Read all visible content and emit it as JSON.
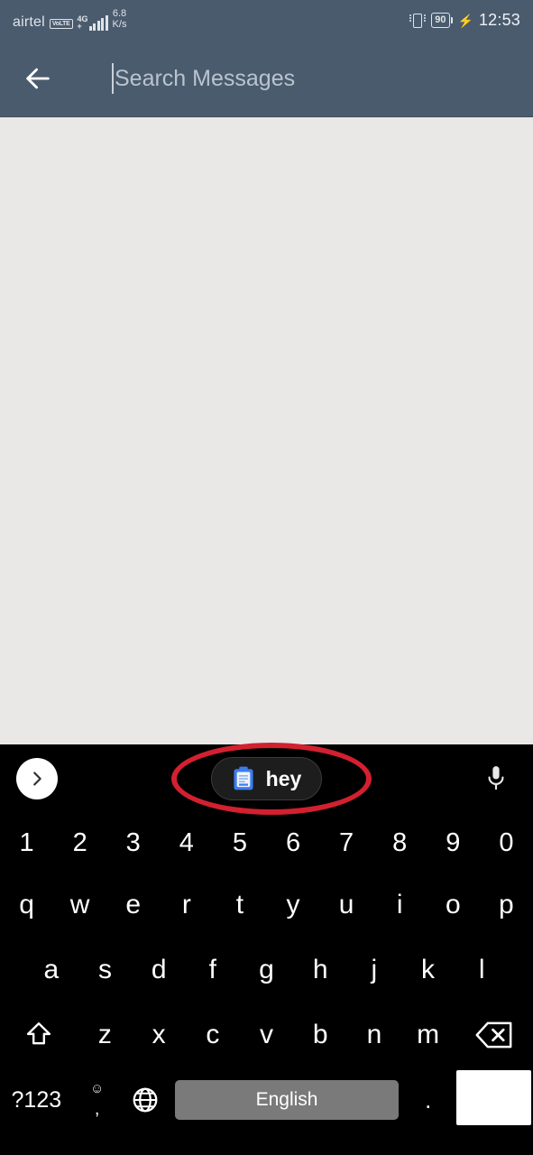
{
  "statusbar": {
    "carrier": "airtel",
    "volte_badge": "VoLTE",
    "network_gen": "4G",
    "network_gen_sub": "+",
    "data_speed_value": "6.8",
    "data_speed_unit": "K/s",
    "vibrate_icon": "vibrate-icon",
    "battery_level": "90",
    "charging_icon": "charging-bolt-icon",
    "clock": "12:53"
  },
  "appbar": {
    "back_icon": "back-arrow-icon",
    "search_placeholder": "Search Messages",
    "search_value": ""
  },
  "content": {
    "background_color": "#e9e8e6"
  },
  "keyboard": {
    "suggestion_strip": {
      "expand_icon": "chevron-right-icon",
      "clipboard_icon": "clipboard-icon",
      "clipboard_suggestion": "hey",
      "mic_icon": "microphone-icon"
    },
    "rows": {
      "numbers": [
        "1",
        "2",
        "3",
        "4",
        "5",
        "6",
        "7",
        "8",
        "9",
        "0"
      ],
      "row1": [
        "q",
        "w",
        "e",
        "r",
        "t",
        "y",
        "u",
        "i",
        "o",
        "p"
      ],
      "row2": [
        "a",
        "s",
        "d",
        "f",
        "g",
        "h",
        "j",
        "k",
        "l"
      ],
      "row3": [
        "z",
        "x",
        "c",
        "v",
        "b",
        "n",
        "m"
      ]
    },
    "shift_icon": "shift-icon",
    "backspace_icon": "backspace-icon",
    "symbols_key": "?123",
    "emoji_icon": "emoji-icon",
    "comma_key": ",",
    "globe_icon": "globe-icon",
    "space_key": "English",
    "period_key": ".",
    "enter_icon": "enter-key"
  },
  "annotation": {
    "highlight_color": "#d32030",
    "shape": "ellipse",
    "target": "clipboard-suggestion-chip"
  }
}
